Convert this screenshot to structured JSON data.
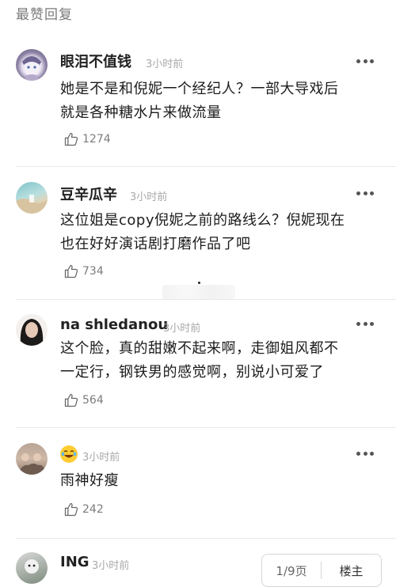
{
  "section_title": "最赞回复",
  "comments": [
    {
      "username": "眼泪不值钱",
      "time": "3小时前",
      "lines": [
        "她是不是和倪妮一个经纪人？一部大导戏后",
        "就是各种糖水片来做流量"
      ],
      "likes": "1274"
    },
    {
      "username": "豆辛瓜辛",
      "time": "3小时前",
      "lines": [
        "这位姐是copy倪妮之前的路线么？倪妮现在",
        "也在好好演话剧打磨作品了吧"
      ],
      "likes": "734"
    },
    {
      "username": "na shledanou",
      "time": "3小时前",
      "lines": [
        "这个脸，真的甜嫩不起来啊，走御姐风都不",
        "一定行，钢铁男的感觉啊，别说小可爱了"
      ],
      "likes": "564"
    },
    {
      "username": "",
      "username_icon": "laughing-crying-emoji-icon",
      "time": "3小时前",
      "lines": [
        "雨神好瘦"
      ],
      "likes": "242"
    },
    {
      "username": "ING",
      "time": "3小时前",
      "lines": [],
      "likes": ""
    }
  ],
  "pager": {
    "page": "1/9页",
    "floor": "楼主"
  },
  "icons": {
    "like": "thumbs-up-icon",
    "more": "more-dots-icon"
  }
}
